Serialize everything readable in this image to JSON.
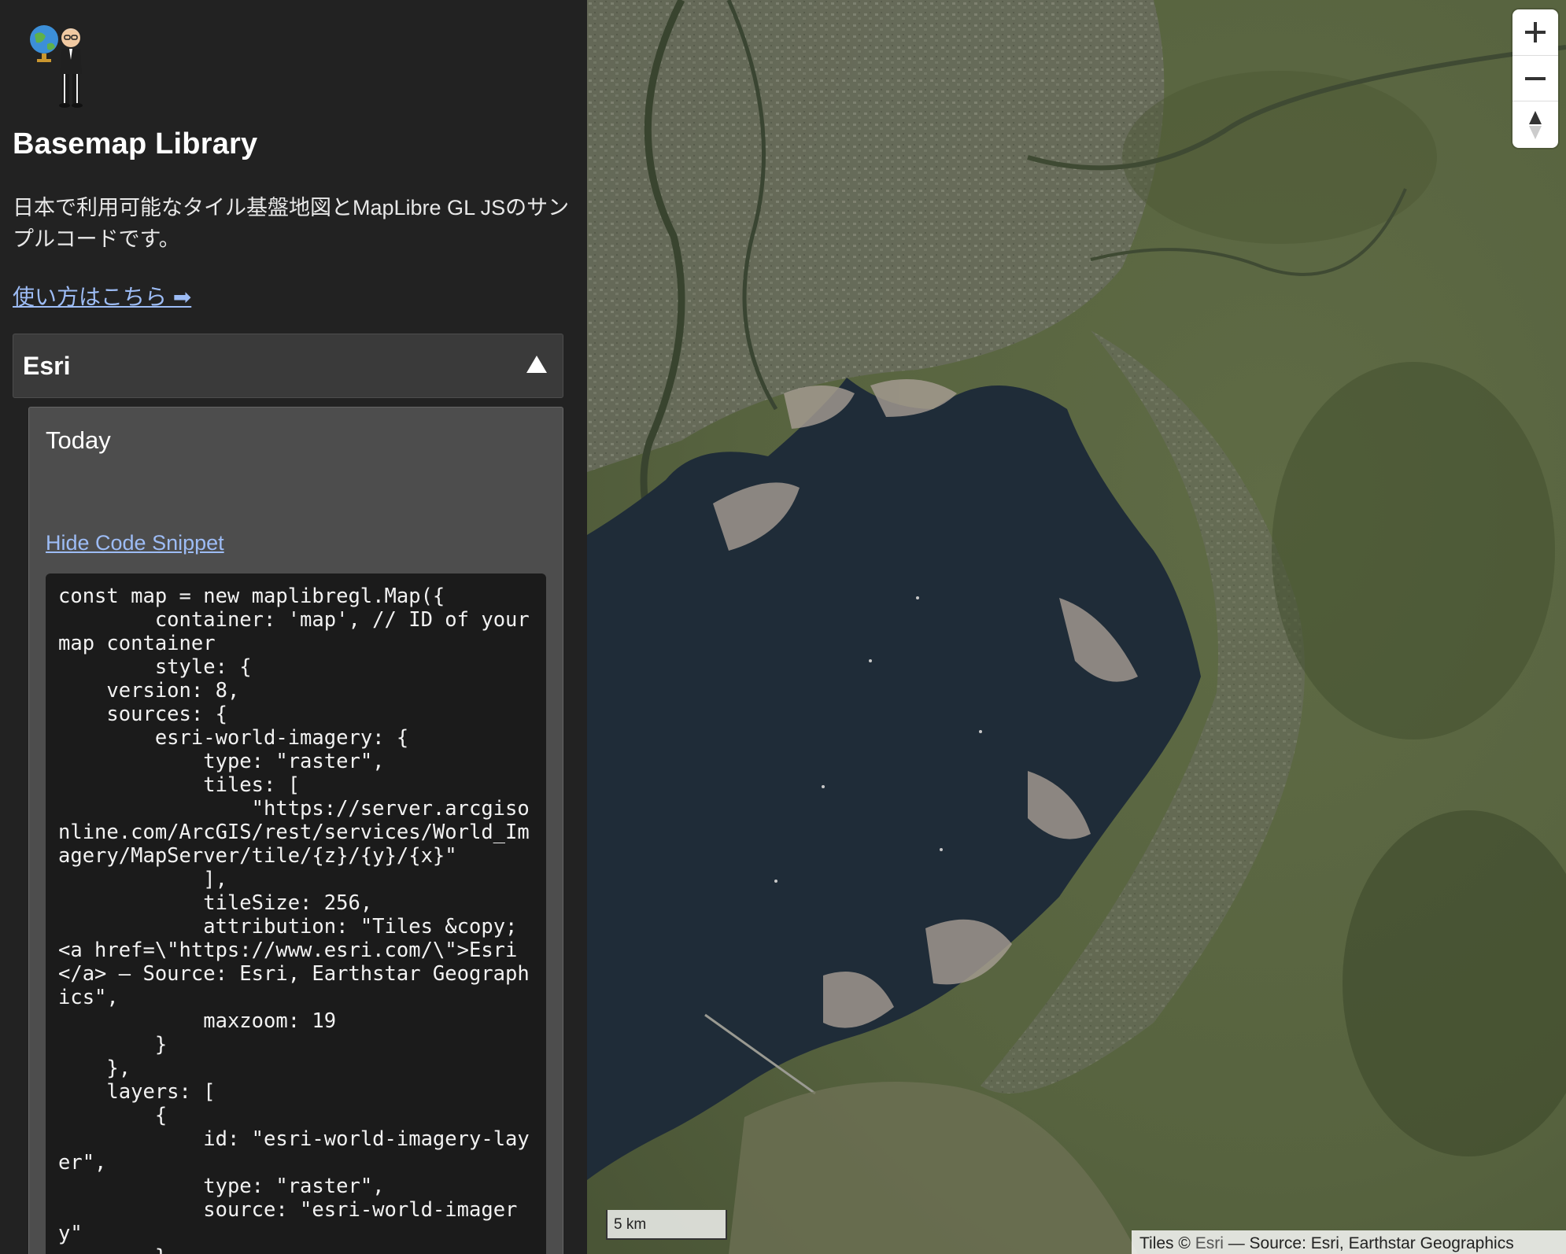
{
  "sidebar": {
    "title": "Basemap Library",
    "description": "日本で利用可能なタイル基盤地図とMapLibre GL JSのサンプルコードです。",
    "usage_link": "使い方はこちら ➡",
    "provider": {
      "name": "Esri",
      "expanded": true,
      "basemap": {
        "title": "Today",
        "toggle_snippet_label": "Hide Code Snippet",
        "code": "const map = new maplibregl.Map({\n        container: 'map', // ID of your map container\n        style: {\n    version: 8,\n    sources: {\n        esri-world-imagery: {\n            type: \"raster\",\n            tiles: [\n                \"https://server.arcgisonline.com/ArcGIS/rest/services/World_Imagery/MapServer/tile/{z}/{y}/{x}\"\n            ],\n            tileSize: 256,\n            attribution: \"Tiles &copy; <a href=\\\"https://www.esri.com/\\\">Esri</a> — Source: Esri, Earthstar Geographics\",\n            maxzoom: 19\n        }\n    },\n    layers: [\n        {\n            id: \"esri-world-imagery-layer\",\n            type: \"raster\",\n            source: \"esri-world-imagery\"\n        }"
      }
    }
  },
  "map": {
    "scale_label": "5 km",
    "attribution": {
      "prefix": "Tiles © ",
      "link": "Esri",
      "suffix": " — Source: Esri, Earthstar Geographics"
    },
    "controls": {
      "zoom_in": "zoom-in",
      "zoom_out": "zoom-out",
      "compass": "reset-bearing"
    }
  },
  "colors": {
    "sidebar_bg": "#222222",
    "link": "#9dbcf5",
    "water": "#1f2c38",
    "land": "#5d6a45"
  }
}
